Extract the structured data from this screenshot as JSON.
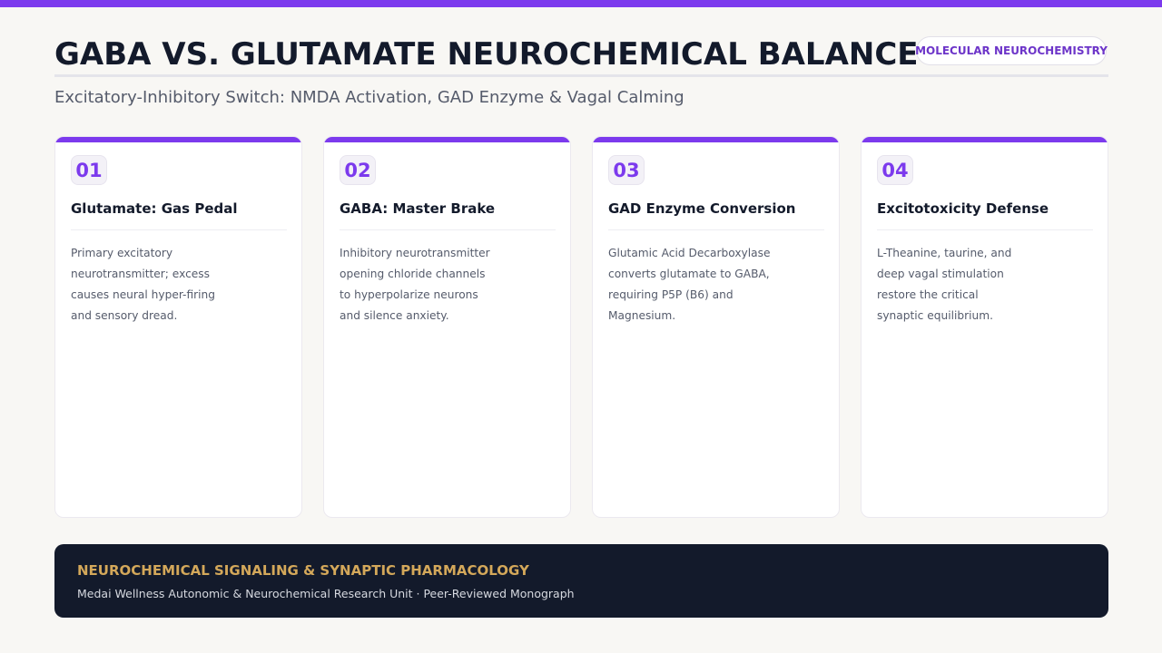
{
  "header": {
    "title": "GABA VS. GLUTAMATE NEUROCHEMICAL BALANCE",
    "badge": "MOLECULAR NEUROCHEMISTRY",
    "subtitle": "Excitatory-Inhibitory Switch: NMDA Activation, GAD Enzyme & Vagal Calming"
  },
  "cards": [
    {
      "number": "01",
      "title": "Glutamate: Gas Pedal",
      "body": "Primary excitatory neurotransmitter; excess causes neural hyper-firing and sensory dread."
    },
    {
      "number": "02",
      "title": "GABA: Master Brake",
      "body": "Inhibitory neurotransmitter opening chloride channels to hyperpolarize neurons and silence anxiety."
    },
    {
      "number": "03",
      "title": "GAD Enzyme Conversion",
      "body": "Glutamic Acid Decarboxylase converts glutamate to GABA, requiring P5P (B6) and Magnesium."
    },
    {
      "number": "04",
      "title": "Excitotoxicity Defense",
      "body": "L-Theanine, taurine, and deep vagal stimulation restore the critical synaptic equilibrium."
    }
  ],
  "footer": {
    "title": "NEUROCHEMICAL SIGNALING & SYNAPTIC PHARMACOLOGY",
    "subtitle": "Medai Wellness Autonomic & Neurochemical Research Unit · Peer-Reviewed Monograph"
  },
  "colors": {
    "accent": "#7c3aed",
    "heading": "#131a2b",
    "footer_background": "#131a2b",
    "footer_title": "#d4a85a"
  }
}
